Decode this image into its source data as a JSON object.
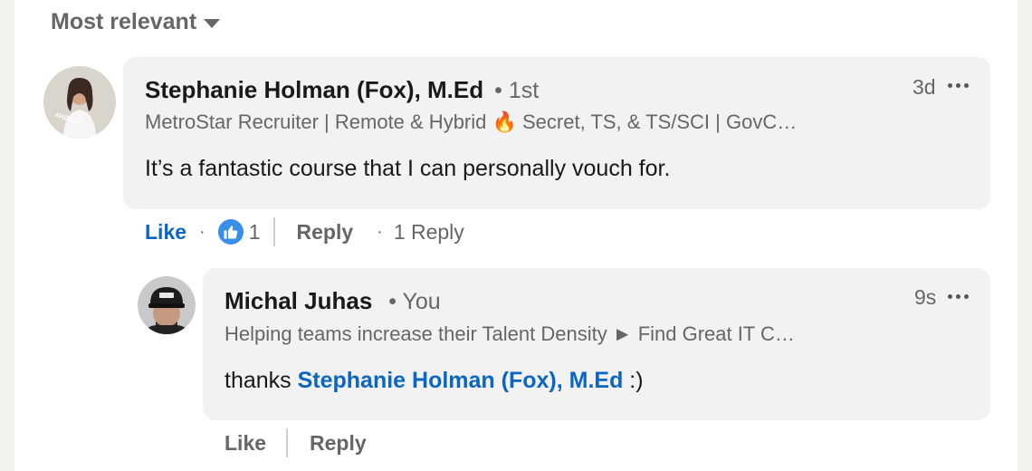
{
  "sort": {
    "label": "Most relevant",
    "icon": "caret-down-icon"
  },
  "comment": {
    "author": "Stephanie Holman (Fox), M.Ed",
    "degree": "• 1st",
    "headline": "MetroStar Recruiter | Remote & Hybrid 🔥 Secret, TS, & TS/SCI | GovC…",
    "avatar_badge": "#HIRING",
    "text": "It’s a fantastic course that I can personally vouch for.",
    "time": "3d",
    "actions": {
      "like": "Like",
      "separator": "·",
      "reaction_icon": "thumbs-up-icon",
      "reaction_count": "1",
      "reply": "Reply",
      "reply_count": "1 Reply"
    }
  },
  "reply": {
    "author": "Michal Juhas",
    "degree": "• You",
    "headline": "Helping teams increase their Talent Density ► Find Great IT C…",
    "text_before": "thanks ",
    "mention": "Stephanie Holman (Fox), M.Ed",
    "text_after": " :)",
    "time": "9s",
    "actions": {
      "like": "Like",
      "reply": "Reply"
    }
  },
  "colors": {
    "accent": "#0a66c2",
    "bubble": "#f2f2f2",
    "muted": "#666666",
    "hiring_ring": "#7f3fbf"
  }
}
